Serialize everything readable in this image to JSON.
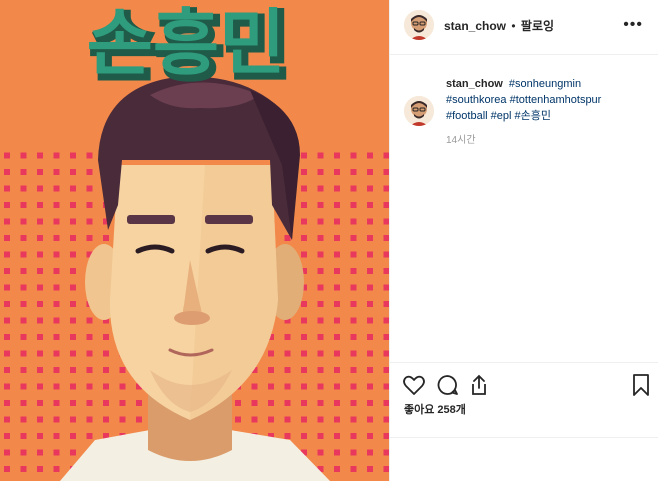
{
  "header": {
    "username": "stan_chow",
    "separator": "•",
    "follow_label": "팔로잉",
    "more_icon": "more-options-icon"
  },
  "artwork": {
    "title_text": "손흥민",
    "background_color": "#f2894a",
    "title_color": "#2e9c7d"
  },
  "caption": {
    "username": "stan_chow",
    "tags": [
      "#sonheungmin",
      "#southkorea",
      "#tottenhamhotspur",
      "#football",
      "#epl",
      "#손흥민"
    ],
    "time": "14시간"
  },
  "actions": {
    "like_icon": "heart-icon",
    "comment_icon": "comment-icon",
    "share_icon": "share-icon",
    "save_icon": "bookmark-icon"
  },
  "likes": {
    "label": "좋아요 258개"
  }
}
